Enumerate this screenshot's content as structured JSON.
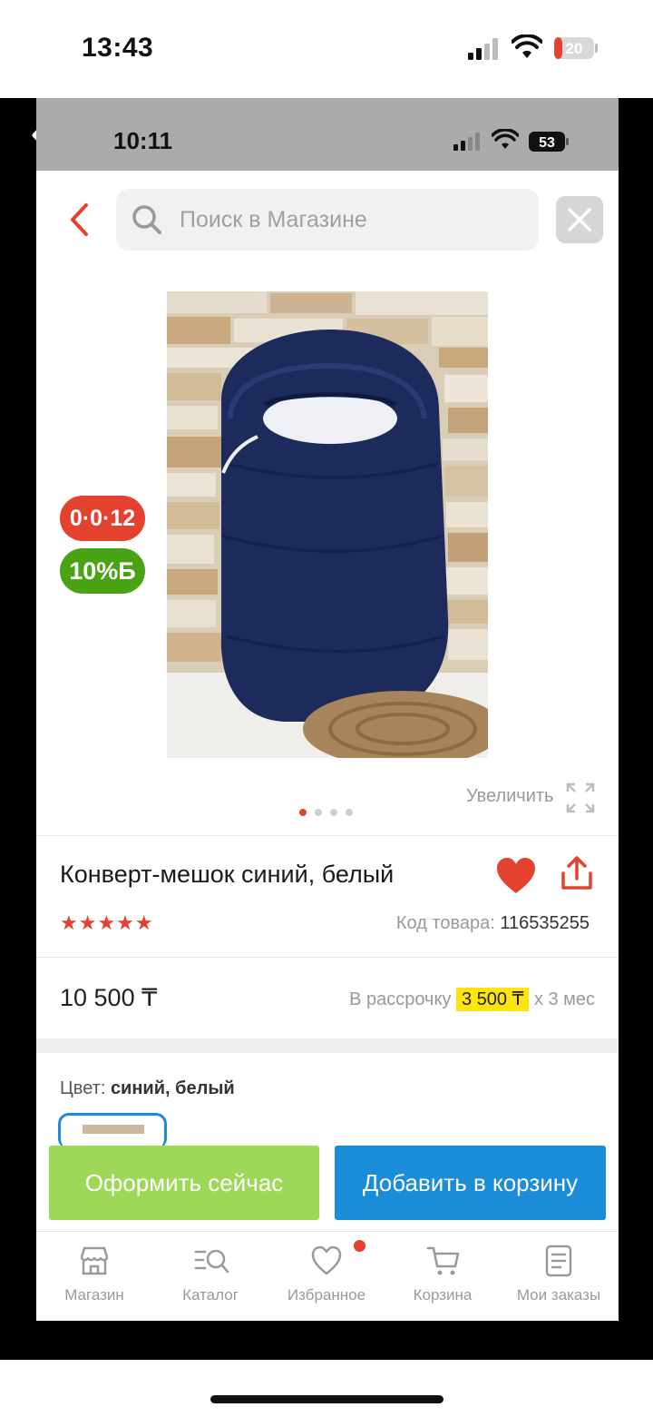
{
  "outer_status": {
    "time": "13:43",
    "battery": "20"
  },
  "inner_status": {
    "time": "10:11",
    "battery": "53"
  },
  "search": {
    "placeholder": "Поиск в Магазине"
  },
  "badges": {
    "installment": "0·0·12",
    "bonus": "10%Б"
  },
  "gallery": {
    "zoom_label": "Увеличить",
    "slides": 4,
    "active_slide": 1
  },
  "product": {
    "title": "Конверт-мешок синий, белый",
    "rating_stars": "★★★★★",
    "rating": 5,
    "code_label": "Код товара:",
    "code_value": "116535255",
    "price": "10 500 ₸",
    "installment_prefix": "В рассрочку",
    "installment_amount": "3 500 ₸",
    "installment_suffix": "х 3 мес",
    "color_label": "Цвет:",
    "color_value": "синий, белый"
  },
  "actions": {
    "buy_now": "Оформить сейчас",
    "add_to_cart": "Добавить в корзину"
  },
  "tabbar": {
    "items": [
      {
        "label": "Магазин",
        "icon": "store-icon"
      },
      {
        "label": "Каталог",
        "icon": "catalog-search-icon"
      },
      {
        "label": "Избранное",
        "icon": "heart-outline-icon"
      },
      {
        "label": "Корзина",
        "icon": "cart-icon"
      },
      {
        "label": "Мои заказы",
        "icon": "orders-icon"
      }
    ]
  },
  "colors": {
    "accent_red": "#e4412f",
    "bonus_green": "#4aa314",
    "buy_now_green": "#9dd858",
    "cart_blue": "#1a8cd8",
    "installment_highlight": "#fde40c"
  }
}
